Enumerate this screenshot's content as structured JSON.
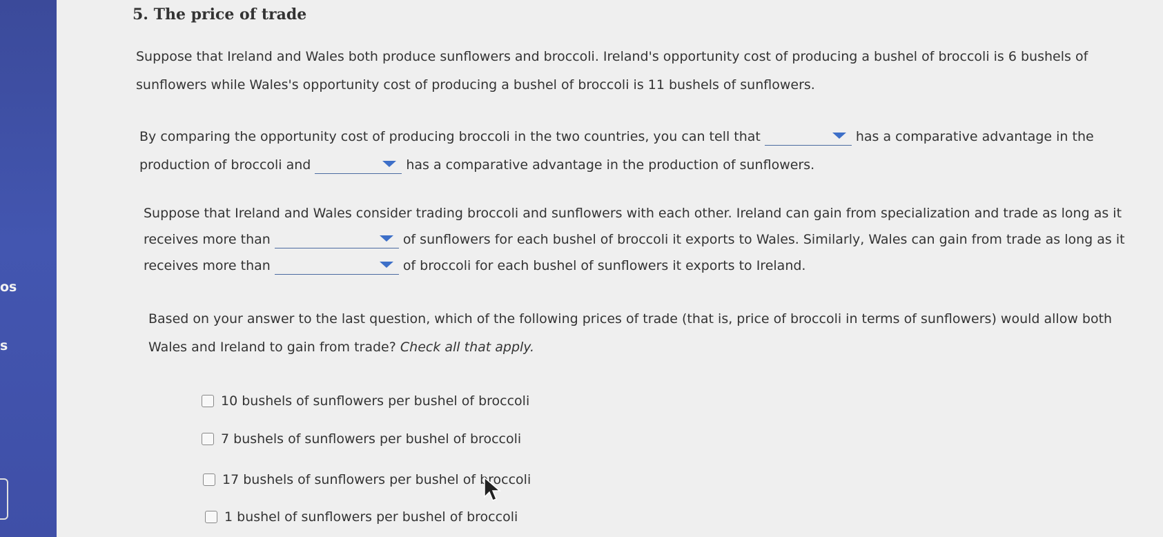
{
  "sidebar": {
    "labels": [
      "os",
      "s"
    ]
  },
  "question": {
    "title": "5. The price of trade",
    "intro_line1": "Suppose that Ireland and Wales both produce sunflowers and broccoli. Ireland's opportunity cost of producing a bushel of broccoli is 6 bushels of",
    "intro_line2": "sunflowers while Wales's opportunity cost of producing a bushel of broccoli is 11 bushels of sunflowers.",
    "compare_a": "By comparing the opportunity cost of producing broccoli in the two countries, you can tell that",
    "compare_b": "has a comparative advantage in the",
    "compare_c": "production of broccoli and",
    "compare_d": "has a comparative advantage in the production of sunflowers.",
    "trade_line1": "Suppose that Ireland and Wales consider trading broccoli and sunflowers with each other. Ireland can gain from specialization and trade as long as it",
    "trade_a": "receives more than",
    "trade_b": "of sunflowers for each bushel of broccoli it exports to Wales. Similarly, Wales can gain from trade as long as it",
    "trade_c": "receives more than",
    "trade_d": "of broccoli for each bushel of sunflowers it exports to Ireland.",
    "based_line1": "Based on your answer to the last question, which of the following prices of trade (that is, price of broccoli in terms of sunflowers) would allow both",
    "based_line2": "Wales and Ireland to gain from trade?",
    "based_hint": "Check all that apply.",
    "options": [
      "10 bushels of sunflowers per bushel of broccoli",
      "7 bushels of sunflowers per bushel of broccoli",
      "17 bushels of sunflowers per bushel of broccoli",
      "1 bushel of sunflowers per bushel of broccoli"
    ]
  },
  "colors": {
    "sidebar": "#4356b0",
    "dropdown_arrow": "#3d6fc8",
    "underline": "#4a6aa0"
  }
}
